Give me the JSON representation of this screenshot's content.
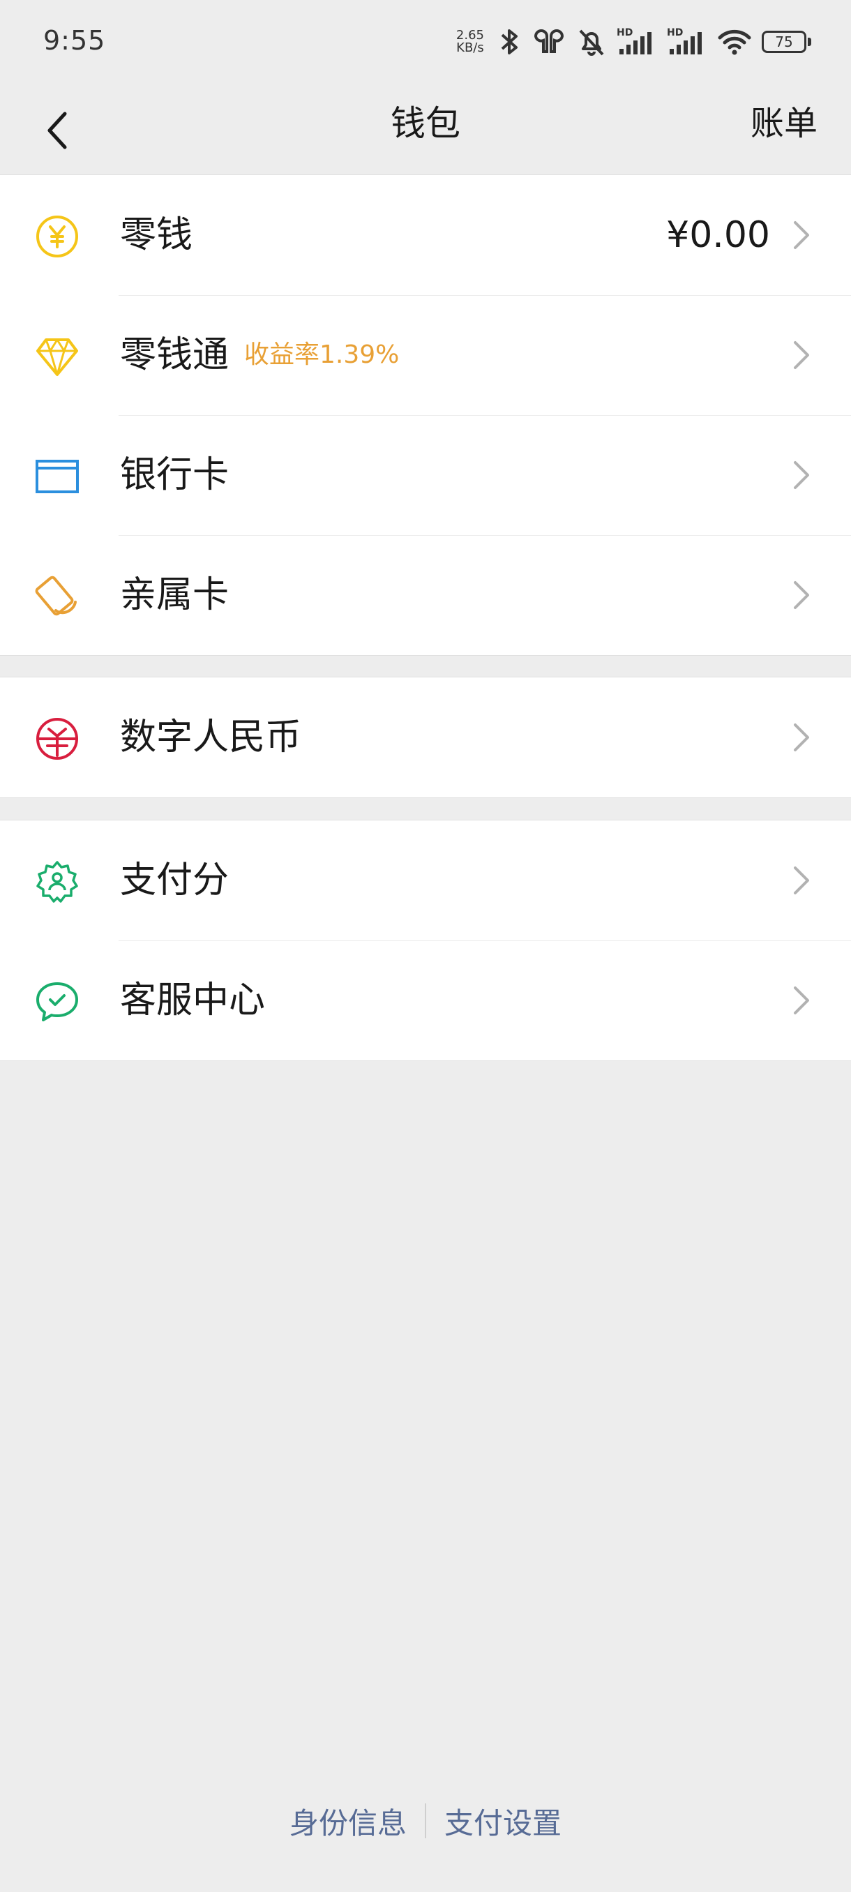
{
  "status_bar": {
    "time": "9:55",
    "net_speed_value": "2.65",
    "net_speed_unit": "KB/s",
    "battery": "75",
    "icons": [
      "bluetooth-icon",
      "earbuds-icon",
      "mute-bell-icon",
      "signal-hd-icon",
      "signal-hd-icon",
      "wifi-icon",
      "battery-icon"
    ]
  },
  "nav": {
    "title": "钱包",
    "action": "账单",
    "back_icon": "chevron-left-icon"
  },
  "groups": [
    {
      "items": [
        {
          "label": "零钱",
          "value": "¥0.00",
          "icon": "yuan-coin-icon",
          "color": "#f5c518"
        },
        {
          "label": "零钱通",
          "sub": "收益率1.39%",
          "icon": "diamond-icon",
          "color": "#f5c518"
        },
        {
          "label": "银行卡",
          "icon": "bank-card-icon",
          "color": "#2b8fde"
        },
        {
          "label": "亲属卡",
          "icon": "family-card-icon",
          "color": "#e8a035"
        }
      ]
    },
    {
      "items": [
        {
          "label": "数字人民币",
          "icon": "digital-rmb-icon",
          "color": "#d81e3e"
        }
      ]
    },
    {
      "items": [
        {
          "label": "支付分",
          "icon": "pay-score-icon",
          "color": "#1aad6c"
        },
        {
          "label": "客服中心",
          "icon": "customer-service-icon",
          "color": "#1aad6c"
        }
      ]
    }
  ],
  "footer": {
    "links": [
      "身份信息",
      "支付设置"
    ]
  }
}
